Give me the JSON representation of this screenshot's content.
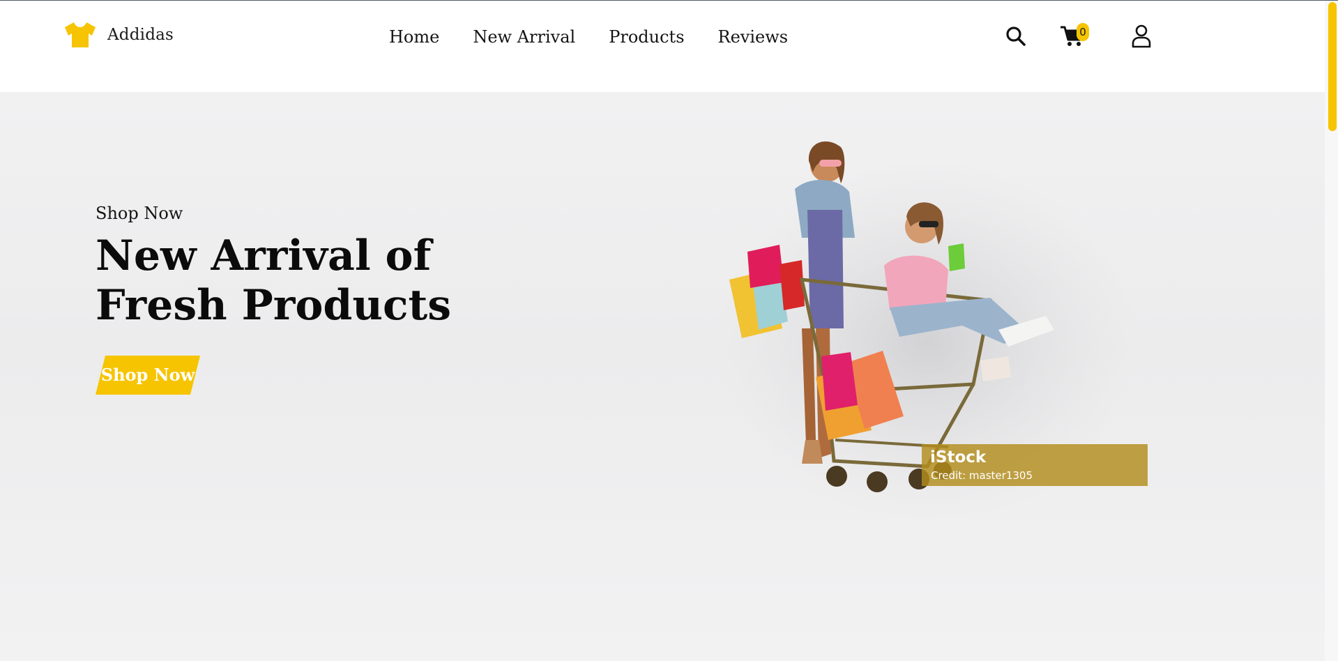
{
  "brand": {
    "name": "Addidas",
    "logo_icon": "tshirt-icon",
    "accent_color": "#f6c400"
  },
  "nav": {
    "items": [
      {
        "label": "Home"
      },
      {
        "label": "New Arrival"
      },
      {
        "label": "Products"
      },
      {
        "label": "Reviews"
      }
    ]
  },
  "header_icons": {
    "search": "search-icon",
    "cart": "cart-icon",
    "cart_count": "0",
    "user": "user-icon"
  },
  "hero": {
    "subtitle": "Shop Now",
    "title_line1": "New Arrival of",
    "title_line2": "Fresh Products",
    "button_label": "Shop Now",
    "image": {
      "watermark_brand": "iStock",
      "watermark_credit": "Credit: master1305"
    }
  }
}
